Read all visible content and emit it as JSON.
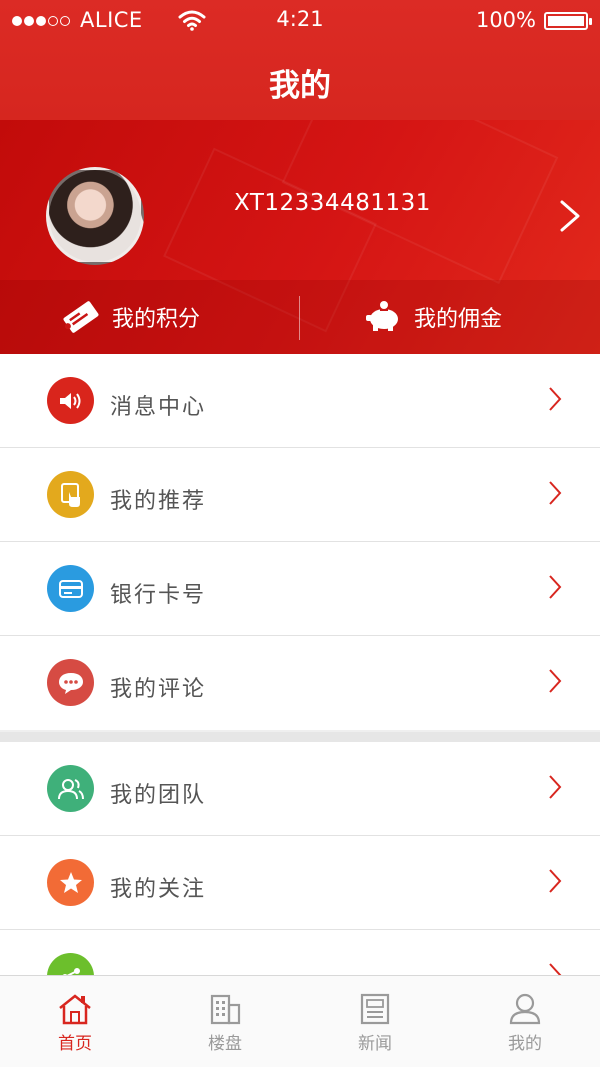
{
  "status_bar": {
    "carrier": "ALICE",
    "time": "4:21",
    "battery": "100%"
  },
  "header": {
    "title": "我的"
  },
  "profile": {
    "user_id": "XT12334481131",
    "actions": [
      {
        "label": "我的积分",
        "icon": "ticket-icon"
      },
      {
        "label": "我的佣金",
        "icon": "piggy-bank-icon"
      }
    ]
  },
  "menu": {
    "group1": [
      {
        "label": "消息中心",
        "icon": "speaker-icon",
        "color": "#d9251c"
      },
      {
        "label": "我的推荐",
        "icon": "hand-pointer-icon",
        "color": "#e3a91d"
      },
      {
        "label": "银行卡号",
        "icon": "bank-card-icon",
        "color": "#2a9be0"
      },
      {
        "label": "我的评论",
        "icon": "chat-bubble-icon",
        "color": "#d64b43"
      }
    ],
    "group2": [
      {
        "label": "我的团队",
        "icon": "team-icon",
        "color": "#3fb07a"
      },
      {
        "label": "我的关注",
        "icon": "star-icon",
        "color": "#f26b36"
      },
      {
        "label": "",
        "icon": "share-icon",
        "color": "#6cbf2c"
      }
    ]
  },
  "tabbar": [
    {
      "label": "首页",
      "icon": "home-icon",
      "active": true
    },
    {
      "label": "楼盘",
      "icon": "building-icon",
      "active": false
    },
    {
      "label": "新闻",
      "icon": "news-icon",
      "active": false
    },
    {
      "label": "我的",
      "icon": "user-icon",
      "active": false
    }
  ],
  "colors": {
    "primary": "#d8261f",
    "text": "#555555",
    "tab_inactive": "#9a9a9a"
  }
}
